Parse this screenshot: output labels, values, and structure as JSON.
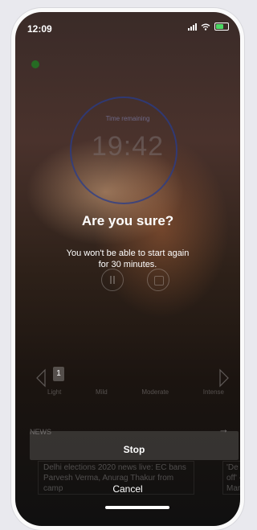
{
  "status_bar": {
    "time": "12:09"
  },
  "timer": {
    "label": "Time remaining",
    "value": "19:42"
  },
  "dialog": {
    "title": "Are you sure?",
    "message": "You won't be able to start again for 30 minutes.",
    "stop_label": "Stop",
    "cancel_label": "Cancel"
  },
  "intensity": {
    "selected": "1",
    "levels": [
      "Light",
      "Mild",
      "Moderate",
      "Intense"
    ]
  },
  "news": {
    "label": "NEWS",
    "cards": [
      "Delhi elections 2020 news live: EC bans Parvesh Verma, Anurag Thakur from camp",
      "'De n off' - Manc"
    ]
  }
}
